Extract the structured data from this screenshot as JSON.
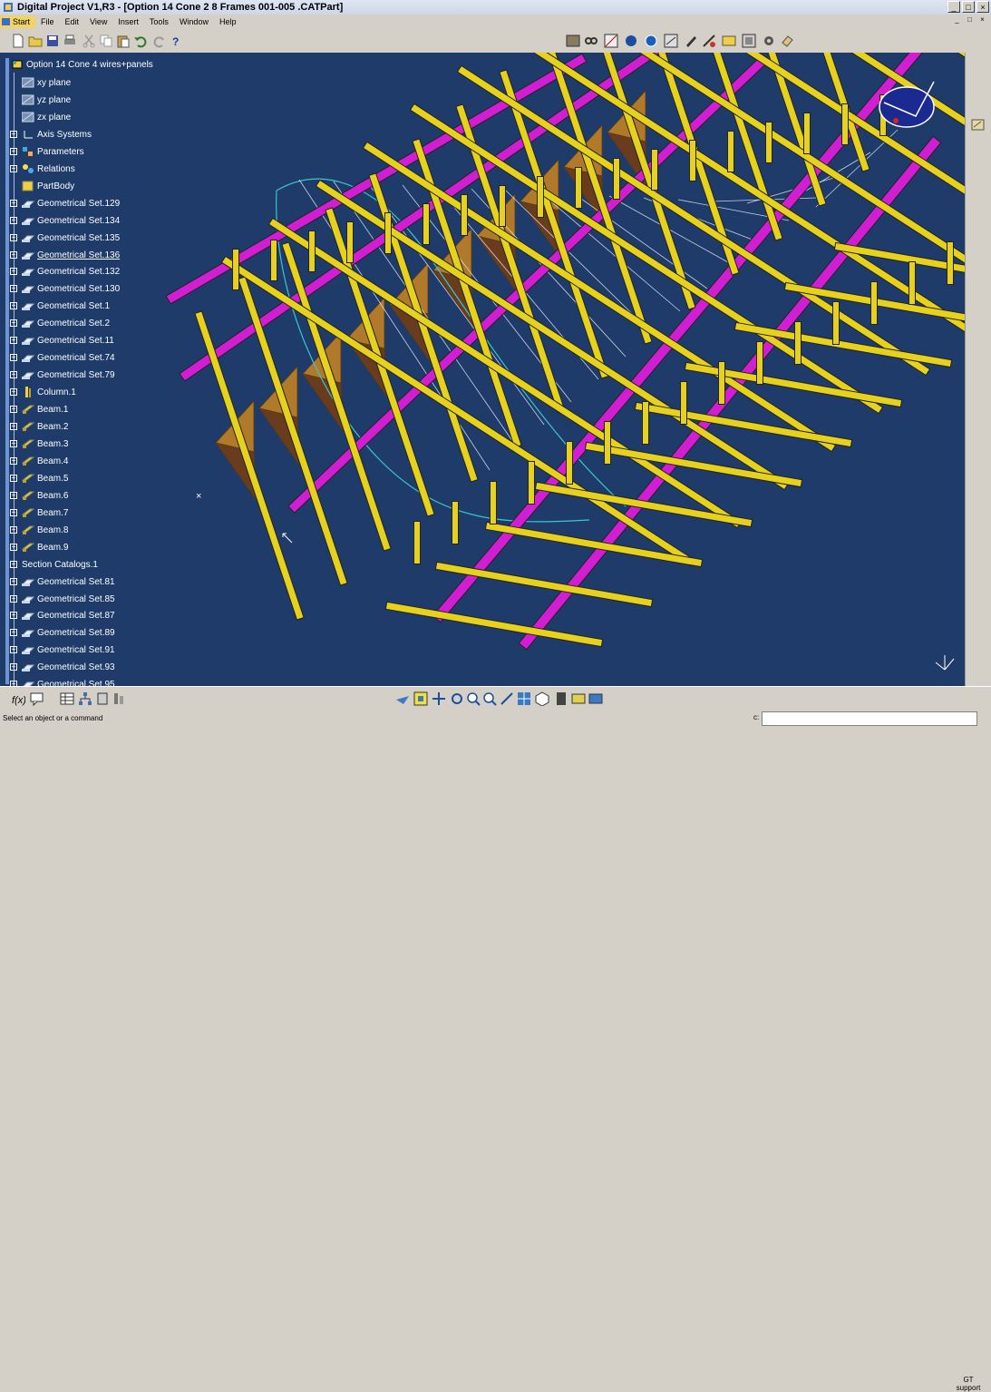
{
  "window": {
    "title": "Digital Project V1,R3 - [Option 14 Cone 2 8 Frames 001-005 .CATPart]",
    "min_label": "_",
    "max_label": "□",
    "close_label": "×"
  },
  "menu": {
    "start": "Start",
    "file": "File",
    "edit": "Edit",
    "view": "View",
    "insert": "Insert",
    "tools": "Tools",
    "window": "Window",
    "help": "Help"
  },
  "tree": {
    "root": "Option 14 Cone 4 wires+panels",
    "items": [
      {
        "label": "xy plane",
        "icon": "plane-icon",
        "expandable": false
      },
      {
        "label": "yz plane",
        "icon": "plane-icon",
        "expandable": false
      },
      {
        "label": "zx plane",
        "icon": "plane-icon",
        "expandable": false
      },
      {
        "label": "Axis Systems",
        "icon": "axis-system-icon",
        "expandable": true
      },
      {
        "label": "Parameters",
        "icon": "parameters-icon",
        "expandable": true
      },
      {
        "label": "Relations",
        "icon": "relations-icon",
        "expandable": true
      },
      {
        "label": "PartBody",
        "icon": "partbody-icon",
        "expandable": false
      },
      {
        "label": "Geometrical Set.129",
        "icon": "geometrical-set-icon",
        "expandable": true
      },
      {
        "label": "Geometrical Set.134",
        "icon": "geometrical-set-icon",
        "expandable": true
      },
      {
        "label": "Geometrical Set.135",
        "icon": "geometrical-set-icon",
        "expandable": true
      },
      {
        "label": "Geometrical Set.136",
        "icon": "geometrical-set-icon",
        "expandable": true,
        "underlined": true
      },
      {
        "label": "Geometrical Set.132",
        "icon": "geometrical-set-icon",
        "expandable": true
      },
      {
        "label": "Geometrical Set.130",
        "icon": "geometrical-set-icon",
        "expandable": true
      },
      {
        "label": "Geometrical Set.1",
        "icon": "geometrical-set-icon",
        "expandable": true
      },
      {
        "label": "Geometrical Set.2",
        "icon": "geometrical-set-icon",
        "expandable": true
      },
      {
        "label": "Geometrical Set.11",
        "icon": "geometrical-set-icon",
        "expandable": true
      },
      {
        "label": "Geometrical Set.74",
        "icon": "geometrical-set-icon",
        "expandable": true
      },
      {
        "label": "Geometrical Set.79",
        "icon": "geometrical-set-icon",
        "expandable": true
      },
      {
        "label": "Column.1",
        "icon": "column-icon",
        "expandable": true
      },
      {
        "label": "Beam.1",
        "icon": "beam-icon",
        "expandable": true
      },
      {
        "label": "Beam.2",
        "icon": "beam-icon",
        "expandable": true
      },
      {
        "label": "Beam.3",
        "icon": "beam-icon",
        "expandable": true
      },
      {
        "label": "Beam.4",
        "icon": "beam-icon",
        "expandable": true
      },
      {
        "label": "Beam.5",
        "icon": "beam-icon",
        "expandable": true
      },
      {
        "label": "Beam.6",
        "icon": "beam-icon",
        "expandable": true
      },
      {
        "label": "Beam.7",
        "icon": "beam-icon",
        "expandable": true
      },
      {
        "label": "Beam.8",
        "icon": "beam-icon",
        "expandable": true
      },
      {
        "label": "Beam.9",
        "icon": "beam-icon",
        "expandable": true
      },
      {
        "label": "Section Catalogs.1",
        "icon": "none",
        "expandable": true
      },
      {
        "label": "Geometrical Set.81",
        "icon": "geometrical-set-icon",
        "expandable": true
      },
      {
        "label": "Geometrical Set.85",
        "icon": "geometrical-set-icon",
        "expandable": true
      },
      {
        "label": "Geometrical Set.87",
        "icon": "geometrical-set-icon",
        "expandable": true
      },
      {
        "label": "Geometrical Set.89",
        "icon": "geometrical-set-icon",
        "expandable": true
      },
      {
        "label": "Geometrical Set.91",
        "icon": "geometrical-set-icon",
        "expandable": true
      },
      {
        "label": "Geometrical Set.93",
        "icon": "geometrical-set-icon",
        "expandable": true
      },
      {
        "label": "Geometrical Set.95",
        "icon": "geometrical-set-icon",
        "expandable": true
      }
    ]
  },
  "status": {
    "prompt": "Select an object or a command",
    "command_label": "c:",
    "command_value": ""
  },
  "support": {
    "line1": "GT",
    "line2": "support"
  },
  "colors": {
    "viewport_bg": "#1f3b6a",
    "beam_yellow": "#e6d21e",
    "beam_magenta": "#d21ed2",
    "panel_brown": "#b07a2a",
    "wire_cyan": "#37c7d0"
  }
}
